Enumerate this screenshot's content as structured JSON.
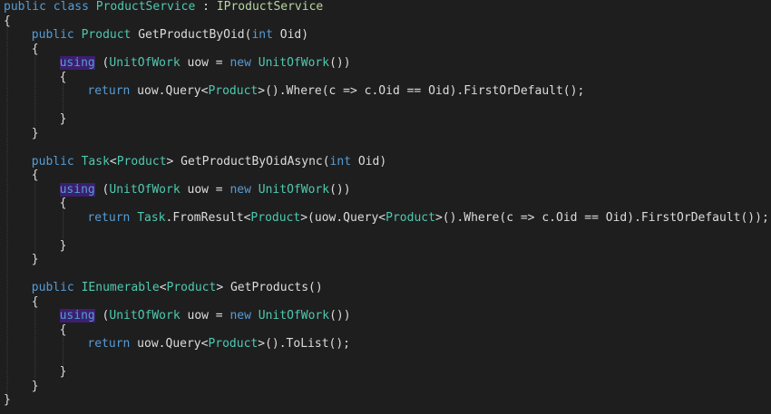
{
  "colors": {
    "background": "#1e1e1e",
    "keyword": "#569cd6",
    "type": "#4ec9b0",
    "interface": "#b8d7a3",
    "plain": "#dcdcdc",
    "guide": "#404040",
    "using_highlight": "#3b1f6e"
  },
  "code": {
    "lines": [
      {
        "indent": 0,
        "tokens": [
          {
            "t": "public",
            "c": "keyword"
          },
          {
            "t": " ",
            "c": "plain"
          },
          {
            "t": "class",
            "c": "keyword"
          },
          {
            "t": " ",
            "c": "plain"
          },
          {
            "t": "ProductService",
            "c": "type"
          },
          {
            "t": " : ",
            "c": "plain"
          },
          {
            "t": "IProductService",
            "c": "interface"
          }
        ]
      },
      {
        "indent": 0,
        "tokens": [
          {
            "t": "{",
            "c": "plain"
          }
        ]
      },
      {
        "indent": 1,
        "tokens": [
          {
            "t": "public",
            "c": "keyword"
          },
          {
            "t": " ",
            "c": "plain"
          },
          {
            "t": "Product",
            "c": "type"
          },
          {
            "t": " GetProductByOid(",
            "c": "plain"
          },
          {
            "t": "int",
            "c": "keyword"
          },
          {
            "t": " Oid)",
            "c": "plain"
          }
        ]
      },
      {
        "indent": 1,
        "tokens": [
          {
            "t": "{",
            "c": "plain"
          }
        ]
      },
      {
        "indent": 2,
        "tokens": [
          {
            "t": "using",
            "c": "keyword",
            "hl": true
          },
          {
            "t": " (",
            "c": "plain"
          },
          {
            "t": "UnitOfWork",
            "c": "type"
          },
          {
            "t": " uow = ",
            "c": "plain"
          },
          {
            "t": "new",
            "c": "keyword"
          },
          {
            "t": " ",
            "c": "plain"
          },
          {
            "t": "UnitOfWork",
            "c": "type"
          },
          {
            "t": "())",
            "c": "plain"
          }
        ]
      },
      {
        "indent": 2,
        "tokens": [
          {
            "t": "{",
            "c": "plain"
          }
        ]
      },
      {
        "indent": 3,
        "tokens": [
          {
            "t": "return",
            "c": "keyword"
          },
          {
            "t": " uow.Query<",
            "c": "plain"
          },
          {
            "t": "Product",
            "c": "type"
          },
          {
            "t": ">().Where(c => c.Oid == Oid).FirstOrDefault();",
            "c": "plain"
          }
        ]
      },
      {
        "indent": 0,
        "tokens": []
      },
      {
        "indent": 2,
        "tokens": [
          {
            "t": "}",
            "c": "plain"
          }
        ]
      },
      {
        "indent": 1,
        "tokens": [
          {
            "t": "}",
            "c": "plain"
          }
        ]
      },
      {
        "indent": 0,
        "tokens": []
      },
      {
        "indent": 1,
        "tokens": [
          {
            "t": "public",
            "c": "keyword"
          },
          {
            "t": " ",
            "c": "plain"
          },
          {
            "t": "Task",
            "c": "type"
          },
          {
            "t": "<",
            "c": "plain"
          },
          {
            "t": "Product",
            "c": "type"
          },
          {
            "t": "> GetProductByOidAsync(",
            "c": "plain"
          },
          {
            "t": "int",
            "c": "keyword"
          },
          {
            "t": " Oid)",
            "c": "plain"
          }
        ]
      },
      {
        "indent": 1,
        "tokens": [
          {
            "t": "{",
            "c": "plain"
          }
        ]
      },
      {
        "indent": 2,
        "tokens": [
          {
            "t": "using",
            "c": "keyword",
            "hl": true
          },
          {
            "t": " (",
            "c": "plain"
          },
          {
            "t": "UnitOfWork",
            "c": "type"
          },
          {
            "t": " uow = ",
            "c": "plain"
          },
          {
            "t": "new",
            "c": "keyword"
          },
          {
            "t": " ",
            "c": "plain"
          },
          {
            "t": "UnitOfWork",
            "c": "type"
          },
          {
            "t": "())",
            "c": "plain"
          }
        ]
      },
      {
        "indent": 2,
        "tokens": [
          {
            "t": "{",
            "c": "plain"
          }
        ]
      },
      {
        "indent": 3,
        "tokens": [
          {
            "t": "return",
            "c": "keyword"
          },
          {
            "t": " ",
            "c": "plain"
          },
          {
            "t": "Task",
            "c": "type"
          },
          {
            "t": ".FromResult<",
            "c": "plain"
          },
          {
            "t": "Product",
            "c": "type"
          },
          {
            "t": ">(uow.Query<",
            "c": "plain"
          },
          {
            "t": "Product",
            "c": "type"
          },
          {
            "t": ">().Where(c => c.Oid == Oid).FirstOrDefault());",
            "c": "plain"
          }
        ]
      },
      {
        "indent": 0,
        "tokens": []
      },
      {
        "indent": 2,
        "tokens": [
          {
            "t": "}",
            "c": "plain"
          }
        ]
      },
      {
        "indent": 1,
        "tokens": [
          {
            "t": "}",
            "c": "plain"
          }
        ]
      },
      {
        "indent": 0,
        "tokens": []
      },
      {
        "indent": 1,
        "tokens": [
          {
            "t": "public",
            "c": "keyword"
          },
          {
            "t": " ",
            "c": "plain"
          },
          {
            "t": "IEnumerable",
            "c": "type"
          },
          {
            "t": "<",
            "c": "plain"
          },
          {
            "t": "Product",
            "c": "type"
          },
          {
            "t": "> GetProducts()",
            "c": "plain"
          }
        ]
      },
      {
        "indent": 1,
        "tokens": [
          {
            "t": "{",
            "c": "plain"
          }
        ]
      },
      {
        "indent": 2,
        "tokens": [
          {
            "t": "using",
            "c": "keyword",
            "hl": true
          },
          {
            "t": " (",
            "c": "plain"
          },
          {
            "t": "UnitOfWork",
            "c": "type"
          },
          {
            "t": " uow = ",
            "c": "plain"
          },
          {
            "t": "new",
            "c": "keyword"
          },
          {
            "t": " ",
            "c": "plain"
          },
          {
            "t": "UnitOfWork",
            "c": "type"
          },
          {
            "t": "())",
            "c": "plain"
          }
        ]
      },
      {
        "indent": 2,
        "tokens": [
          {
            "t": "{",
            "c": "plain"
          }
        ]
      },
      {
        "indent": 3,
        "tokens": [
          {
            "t": "return",
            "c": "keyword"
          },
          {
            "t": " uow.Query<",
            "c": "plain"
          },
          {
            "t": "Product",
            "c": "type"
          },
          {
            "t": ">().ToList();",
            "c": "plain"
          }
        ]
      },
      {
        "indent": 0,
        "tokens": []
      },
      {
        "indent": 2,
        "tokens": [
          {
            "t": "}",
            "c": "plain"
          }
        ]
      },
      {
        "indent": 1,
        "tokens": [
          {
            "t": "}",
            "c": "plain"
          }
        ]
      },
      {
        "indent": 0,
        "tokens": [
          {
            "t": "}",
            "c": "plain"
          }
        ]
      }
    ]
  }
}
